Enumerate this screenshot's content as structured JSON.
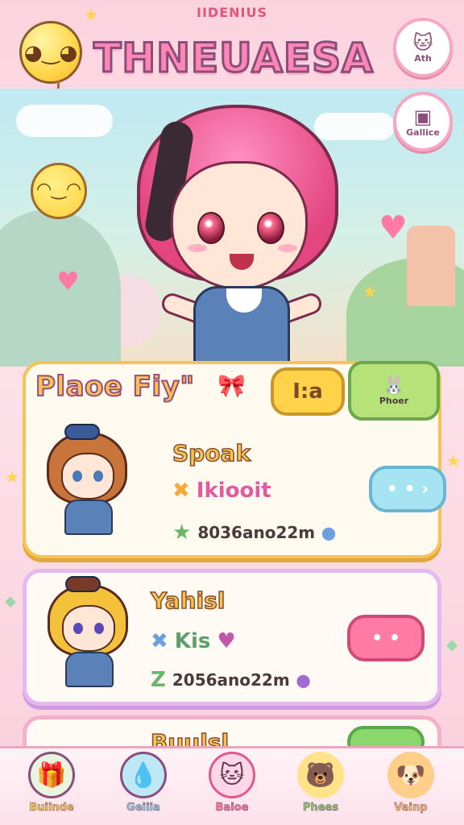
{
  "header": {
    "small_title": "IIDENIUS",
    "title": "THNEUAESA",
    "buttons": [
      {
        "label": "Ath",
        "icon": "cat-icon"
      },
      {
        "label": "Gallice",
        "icon": "robot-icon"
      }
    ]
  },
  "panel": {
    "title": "Plaoe Fiy\"",
    "yellow_pill": "I:a",
    "green_tag": "Phoer"
  },
  "cards": [
    {
      "name": "Spoak",
      "line1": "Ikiooit",
      "line2": "8036ano22m",
      "action_icon": "• • ›"
    },
    {
      "name": "Yahisl",
      "line1": "Kis",
      "line2": "2056ano22m",
      "action_icon": "• •"
    },
    {
      "name": "Buulsl",
      "line1": "",
      "line2": "",
      "action_icon": ""
    }
  ],
  "nav": [
    {
      "label": "Buiinde",
      "icon": "gift-icon",
      "color": "#ffd24a"
    },
    {
      "label": "Geiiia",
      "icon": "drop-icon",
      "color": "#8ad4ee"
    },
    {
      "label": "Baioe",
      "icon": "cat-icon",
      "color": "#ffd6e8"
    },
    {
      "label": "Phees",
      "icon": "bear-icon",
      "color": "#ffd24a"
    },
    {
      "label": "Vainp",
      "icon": "dog-icon",
      "color": "#ffbf6a"
    }
  ],
  "colors": {
    "accent_pink": "#ff7aa5",
    "accent_yellow": "#f6c454",
    "accent_green": "#8ad86a"
  }
}
